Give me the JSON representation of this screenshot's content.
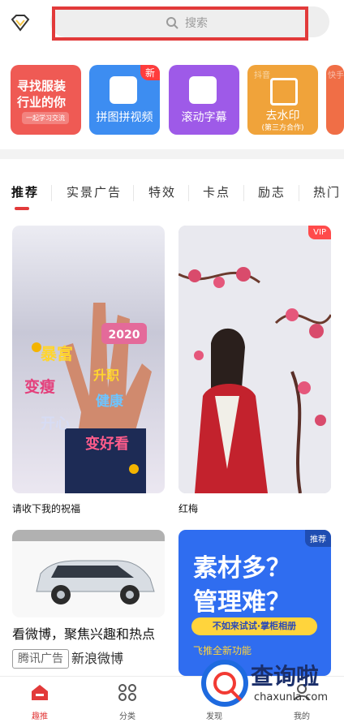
{
  "search": {
    "placeholder": "搜索"
  },
  "tools": [
    {
      "label": "寻找服装\n行业的你",
      "sub": "一起学习交流",
      "color": "#ef5a54"
    },
    {
      "label": "拼图拼视频",
      "badge": "新",
      "color": "#3d8df1"
    },
    {
      "label": "滚动字幕",
      "color": "#9e5ae8"
    },
    {
      "label": "去水印",
      "sub": "(第三方合作)",
      "ghost": "抖音",
      "color": "#f0a33a"
    },
    {
      "ghost": "快手",
      "color": "#f06e46"
    }
  ],
  "tabs": [
    "推荐",
    "实景广告",
    "特效",
    "卡点",
    "励志",
    "热门"
  ],
  "cards": [
    {
      "caption": "请收下我的祝福",
      "stickers": [
        "2020",
        "暴富",
        "变瘦",
        "开心",
        "健康",
        "变好看",
        "升职"
      ]
    },
    {
      "caption": "红梅",
      "badge": "VIP"
    },
    {
      "ad_title": "看微博，聚焦兴趣和热点",
      "ad_tag": "腾讯广告",
      "ad_source": "新浪微博"
    },
    {
      "badge": "推荐",
      "headline1": "素材多？",
      "headline2": "管理难？",
      "cta": "不如来试试·掌柜相册",
      "foot": "飞推全新功能"
    }
  ],
  "nav": [
    {
      "label": "趣推",
      "active": true,
      "icon": "home-icon"
    },
    {
      "label": "分类",
      "icon": "grid-icon"
    },
    {
      "label": "发现",
      "icon": "compass-icon"
    },
    {
      "label": "我的",
      "icon": "user-icon"
    }
  ],
  "watermark": {
    "brand": "查询啦",
    "domain": "chaxunla.com"
  },
  "colors": {
    "accent": "#e23a3a"
  }
}
